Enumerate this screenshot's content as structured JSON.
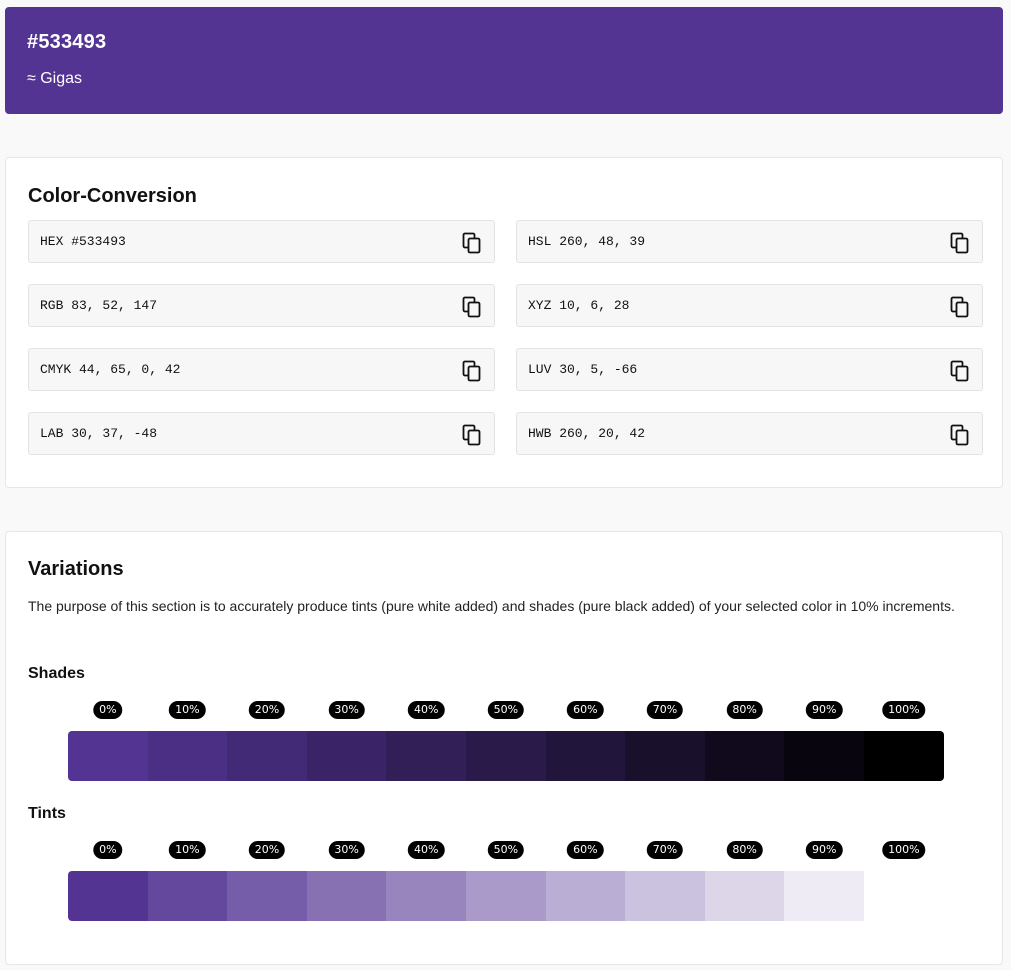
{
  "hero": {
    "hex": "#533493",
    "name": "≈ Gigas",
    "color": "#533493"
  },
  "conversion": {
    "title": "Color-Conversion",
    "items": [
      {
        "label": "HEX #533493"
      },
      {
        "label": "HSL 260, 48, 39"
      },
      {
        "label": "RGB 83, 52, 147"
      },
      {
        "label": "XYZ 10, 6, 28"
      },
      {
        "label": "CMYK 44, 65, 0, 42"
      },
      {
        "label": "LUV 30, 5, -66"
      },
      {
        "label": "LAB 30, 37, -48"
      },
      {
        "label": "HWB 260, 20, 42"
      }
    ],
    "copy_icon": "copy-icon"
  },
  "variations": {
    "title": "Variations",
    "description": "The purpose of this section is to accurately produce tints (pure white added) and shades (pure black added) of your selected color in 10% increments.",
    "shades": {
      "title": "Shades",
      "labels": [
        "0%",
        "10%",
        "20%",
        "30%",
        "40%",
        "50%",
        "60%",
        "70%",
        "80%",
        "90%",
        "100%"
      ],
      "colors": [
        "#533493",
        "#4b2f84",
        "#422a76",
        "#3a2467",
        "#321f58",
        "#2a1a4a",
        "#21153b",
        "#19102c",
        "#110a1d",
        "#08050f",
        "#000000"
      ]
    },
    "tints": {
      "title": "Tints",
      "labels": [
        "0%",
        "10%",
        "20%",
        "30%",
        "40%",
        "50%",
        "60%",
        "70%",
        "80%",
        "90%",
        "100%"
      ],
      "colors": [
        "#533493",
        "#64489e",
        "#755da9",
        "#8771b3",
        "#9885be",
        "#a99ac9",
        "#baaed4",
        "#cbc2df",
        "#ddd6e9",
        "#eeebf4",
        "#ffffff"
      ]
    }
  }
}
